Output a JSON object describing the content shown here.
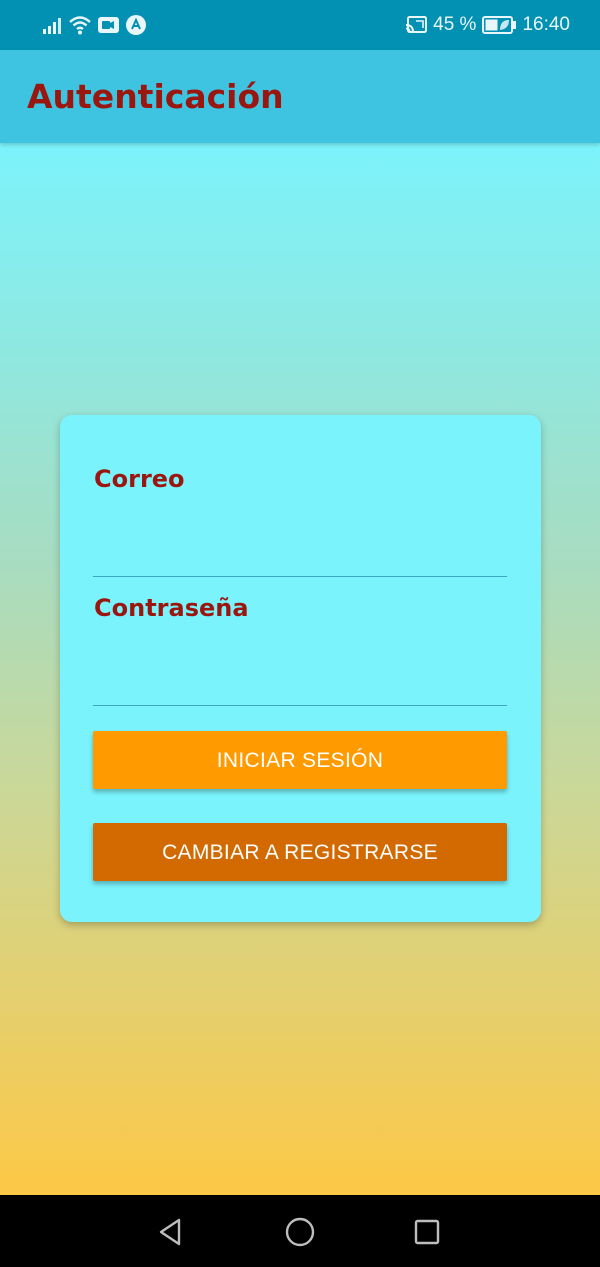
{
  "status_bar": {
    "battery_percent": "45 %",
    "time": "16:40",
    "icons": [
      "signal-icon",
      "wifi-icon",
      "video-call-icon",
      "app-notification-icon",
      "cast-icon",
      "battery-icon"
    ]
  },
  "app_bar": {
    "title": "Autenticación"
  },
  "form": {
    "email_label": "Correo",
    "email_value": "",
    "password_label": "Contraseña",
    "password_value": "",
    "login_button": "INICIAR SESIÓN",
    "switch_button": "CAMBIAR A REGISTRARSE"
  },
  "colors": {
    "status_bar": "#0291b3",
    "app_bar": "#3ec4e1",
    "title_text": "#9a1710",
    "card": "#7af3fc",
    "login_button": "#ff9a00",
    "switch_button": "#d26901",
    "gradient_top": "#7cf3fb",
    "gradient_bottom": "#fdc846"
  },
  "nav_bar": {
    "icons": [
      "back-icon",
      "home-icon",
      "recents-icon"
    ]
  }
}
